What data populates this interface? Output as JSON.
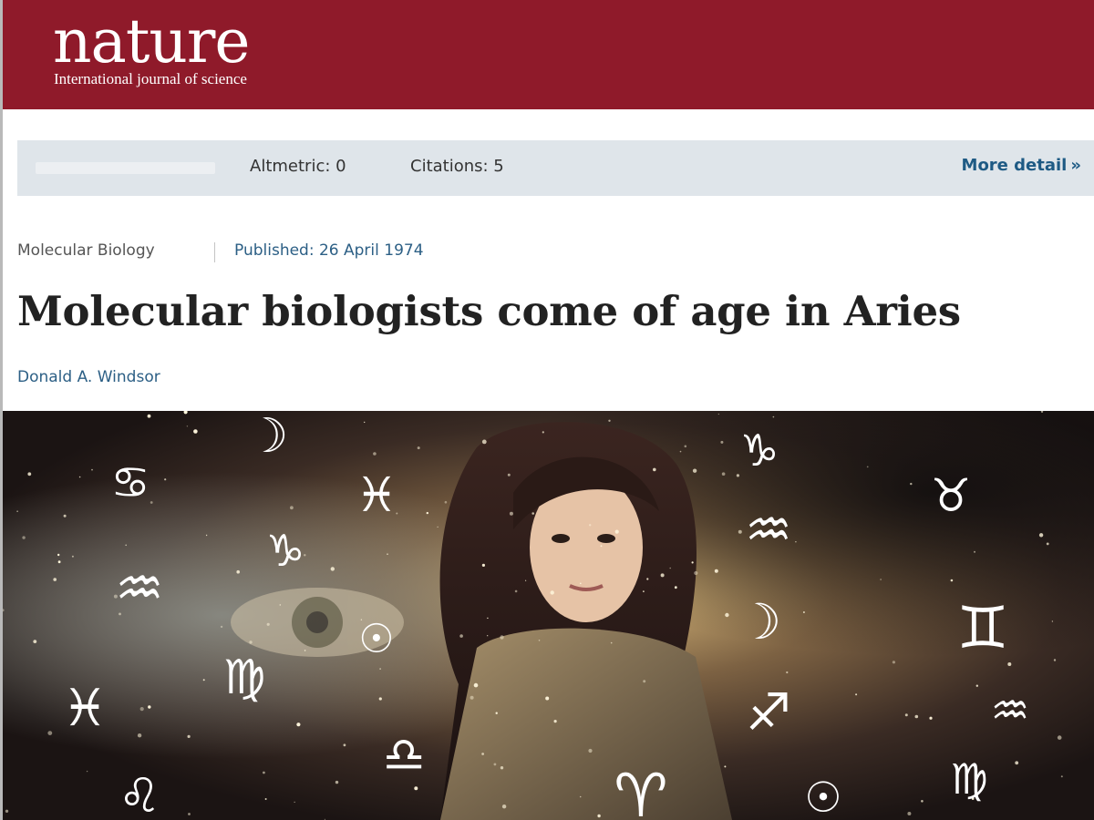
{
  "masthead": {
    "logo": "nature",
    "tagline": "International journal of science"
  },
  "metrics": {
    "altmetric": "Altmetric: 0",
    "citations": "Citations: 5",
    "more_detail": "More detail",
    "more_detail_icon": "»"
  },
  "article": {
    "subject": "Molecular Biology",
    "published": "Published: 26 April 1974",
    "title": "Molecular biologists come of age in Aries",
    "author": "Donald A. Windsor"
  },
  "hero": {
    "zodiac_symbols": [
      "☽",
      "♋",
      "♓",
      "♑",
      "♒",
      "♉",
      "♑",
      "♒",
      "☉",
      "♊",
      "♒",
      "☽",
      "♍",
      "♓",
      "♐",
      "♎",
      "♌",
      "♈",
      "♍",
      "☉"
    ]
  }
}
